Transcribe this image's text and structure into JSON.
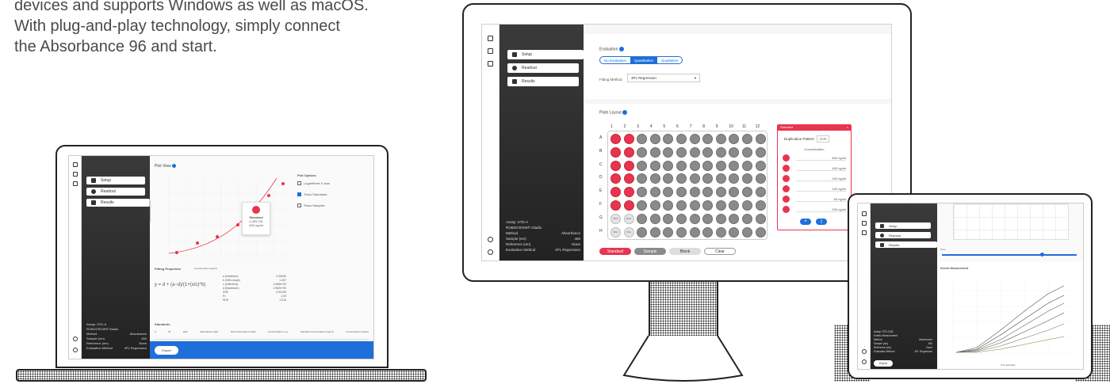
{
  "intro": {
    "line1": "devices and supports Windows as well as macOS.",
    "line2": "With plug-and-play technology, simply connect",
    "line3": "the Absorbance 96 and start."
  },
  "nav": {
    "setup": "Setup",
    "readout": "Readout",
    "results": "Results"
  },
  "laptop": {
    "plot_title": "Plot View",
    "plot_options": "Plot Options",
    "opt_log": "Logarithmic X-axis",
    "opt_standards": "Show Standards",
    "opt_samples": "Show Samples",
    "tooltip": {
      "title": "Standard",
      "od": "0.425",
      "od_unit": "OD",
      "conc": "400",
      "conc_unit": "ng/ml"
    },
    "x_axis_label": "Concentration (ng/ml)",
    "y_axis_label": "Optical Density (OD)",
    "fitting_title": "Fitting Properties",
    "fitting_rows": [
      [
        "a (Minimum)",
        "0.03940"
      ],
      [
        "b (Hill's slope)",
        "1.407"
      ],
      [
        "c (Inflection)",
        "1.566e+03"
      ],
      [
        "d (Maximum)",
        "1.962e+00"
      ],
      [
        "SSE",
        "0.00105"
      ],
      [
        "R²",
        "1.00"
      ],
      [
        "SDE",
        "1.015"
      ]
    ],
    "standards_title": "Standards",
    "table_headers": [
      "#",
      "ID",
      "Well",
      "Absorbance (OD)",
      "Mean Absorbance (OD)",
      "Concentration (x,y)",
      "Standard Concentration (ng/ml)",
      "Concentration (ng/ml)"
    ],
    "assay_title": "Assay: STD-A",
    "assay_sub": "ROBOCROW® Gladio",
    "info_rows": [
      [
        "Method",
        "Absorbance"
      ],
      [
        "Sample (nm)",
        "450"
      ],
      [
        "Reference (nm)",
        "None"
      ],
      [
        "Evaluation Method",
        "4PL Regression"
      ]
    ],
    "export_label": "Export"
  },
  "monitor": {
    "evaluation_label": "Evaluation",
    "eval_options": [
      "No Evaluation",
      "Quantitative",
      "Qualitative"
    ],
    "fitting_method_label": "Fitting Method",
    "fitting_method_value": "4PL Regression",
    "plate_layout_label": "Plate Layout",
    "columns": [
      "1",
      "2",
      "3",
      "4",
      "5",
      "6",
      "7",
      "8",
      "9",
      "10",
      "11",
      "12"
    ],
    "rows": [
      "A",
      "B",
      "C",
      "D",
      "E",
      "F",
      "G",
      "H"
    ],
    "blank_label": "Blnk",
    "panel_title": "Standard",
    "dup_pattern_label": "Duplication Pattern",
    "dup_pattern_value": "A-H",
    "concentration_label": "Concentration",
    "concentrations": [
      "800  ng/ml",
      "400  ng/ml",
      "200  ng/ml",
      "100  ng/ml",
      "50  ng/ml",
      "200  ng/ml"
    ],
    "buttons": {
      "standard": "Standard",
      "sample": "Sample",
      "blank": "Blank",
      "clear": "Clear"
    },
    "assay_title": "Assay: STD-A",
    "assay_sub": "ROBOCROW® Gladio",
    "info_rows": [
      [
        "Method",
        "Absorbance"
      ],
      [
        "Sample (nm)",
        "450"
      ],
      [
        "Reference (nm)",
        "None"
      ],
      [
        "Evaluation Method",
        "4PL Regression"
      ]
    ]
  },
  "tablet": {
    "kinetic_title": "Kinetic Measurement",
    "time_label": "Time",
    "time_axis_label": "Time [minutes]",
    "export_label": "Export",
    "assay_title": "Assay: STD-CAB",
    "assay_sub": "Kinetic Measurement",
    "info_rows": [
      [
        "Method",
        "Absorbance"
      ],
      [
        "Sample (nm)",
        "450"
      ],
      [
        "Reference (nm)",
        "None"
      ],
      [
        "Evaluation Method",
        "4PL Regression"
      ]
    ]
  }
}
